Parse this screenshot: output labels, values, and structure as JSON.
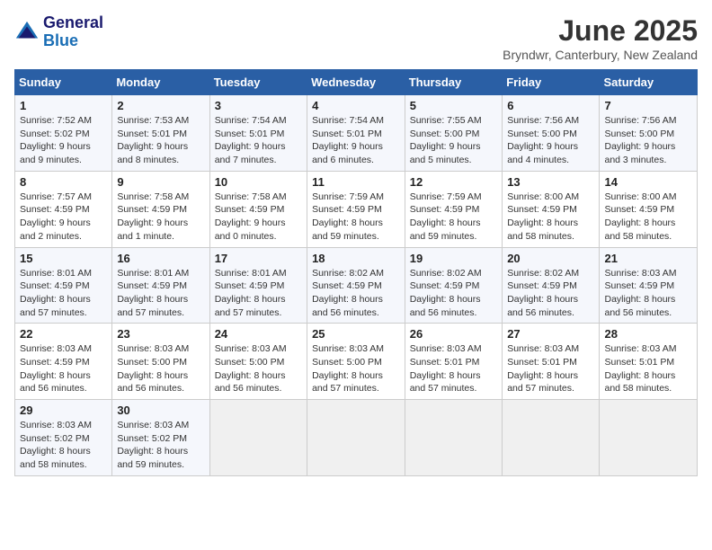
{
  "logo": {
    "text_general": "General",
    "text_blue": "Blue"
  },
  "title": "June 2025",
  "subtitle": "Bryndwr, Canterbury, New Zealand",
  "weekdays": [
    "Sunday",
    "Monday",
    "Tuesday",
    "Wednesday",
    "Thursday",
    "Friday",
    "Saturday"
  ],
  "weeks": [
    [
      {
        "day": "1",
        "content": "Sunrise: 7:52 AM\nSunset: 5:02 PM\nDaylight: 9 hours and 9 minutes."
      },
      {
        "day": "2",
        "content": "Sunrise: 7:53 AM\nSunset: 5:01 PM\nDaylight: 9 hours and 8 minutes."
      },
      {
        "day": "3",
        "content": "Sunrise: 7:54 AM\nSunset: 5:01 PM\nDaylight: 9 hours and 7 minutes."
      },
      {
        "day": "4",
        "content": "Sunrise: 7:54 AM\nSunset: 5:01 PM\nDaylight: 9 hours and 6 minutes."
      },
      {
        "day": "5",
        "content": "Sunrise: 7:55 AM\nSunset: 5:00 PM\nDaylight: 9 hours and 5 minutes."
      },
      {
        "day": "6",
        "content": "Sunrise: 7:56 AM\nSunset: 5:00 PM\nDaylight: 9 hours and 4 minutes."
      },
      {
        "day": "7",
        "content": "Sunrise: 7:56 AM\nSunset: 5:00 PM\nDaylight: 9 hours and 3 minutes."
      }
    ],
    [
      {
        "day": "8",
        "content": "Sunrise: 7:57 AM\nSunset: 4:59 PM\nDaylight: 9 hours and 2 minutes."
      },
      {
        "day": "9",
        "content": "Sunrise: 7:58 AM\nSunset: 4:59 PM\nDaylight: 9 hours and 1 minute."
      },
      {
        "day": "10",
        "content": "Sunrise: 7:58 AM\nSunset: 4:59 PM\nDaylight: 9 hours and 0 minutes."
      },
      {
        "day": "11",
        "content": "Sunrise: 7:59 AM\nSunset: 4:59 PM\nDaylight: 8 hours and 59 minutes."
      },
      {
        "day": "12",
        "content": "Sunrise: 7:59 AM\nSunset: 4:59 PM\nDaylight: 8 hours and 59 minutes."
      },
      {
        "day": "13",
        "content": "Sunrise: 8:00 AM\nSunset: 4:59 PM\nDaylight: 8 hours and 58 minutes."
      },
      {
        "day": "14",
        "content": "Sunrise: 8:00 AM\nSunset: 4:59 PM\nDaylight: 8 hours and 58 minutes."
      }
    ],
    [
      {
        "day": "15",
        "content": "Sunrise: 8:01 AM\nSunset: 4:59 PM\nDaylight: 8 hours and 57 minutes."
      },
      {
        "day": "16",
        "content": "Sunrise: 8:01 AM\nSunset: 4:59 PM\nDaylight: 8 hours and 57 minutes."
      },
      {
        "day": "17",
        "content": "Sunrise: 8:01 AM\nSunset: 4:59 PM\nDaylight: 8 hours and 57 minutes."
      },
      {
        "day": "18",
        "content": "Sunrise: 8:02 AM\nSunset: 4:59 PM\nDaylight: 8 hours and 56 minutes."
      },
      {
        "day": "19",
        "content": "Sunrise: 8:02 AM\nSunset: 4:59 PM\nDaylight: 8 hours and 56 minutes."
      },
      {
        "day": "20",
        "content": "Sunrise: 8:02 AM\nSunset: 4:59 PM\nDaylight: 8 hours and 56 minutes."
      },
      {
        "day": "21",
        "content": "Sunrise: 8:03 AM\nSunset: 4:59 PM\nDaylight: 8 hours and 56 minutes."
      }
    ],
    [
      {
        "day": "22",
        "content": "Sunrise: 8:03 AM\nSunset: 4:59 PM\nDaylight: 8 hours and 56 minutes."
      },
      {
        "day": "23",
        "content": "Sunrise: 8:03 AM\nSunset: 5:00 PM\nDaylight: 8 hours and 56 minutes."
      },
      {
        "day": "24",
        "content": "Sunrise: 8:03 AM\nSunset: 5:00 PM\nDaylight: 8 hours and 56 minutes."
      },
      {
        "day": "25",
        "content": "Sunrise: 8:03 AM\nSunset: 5:00 PM\nDaylight: 8 hours and 57 minutes."
      },
      {
        "day": "26",
        "content": "Sunrise: 8:03 AM\nSunset: 5:01 PM\nDaylight: 8 hours and 57 minutes."
      },
      {
        "day": "27",
        "content": "Sunrise: 8:03 AM\nSunset: 5:01 PM\nDaylight: 8 hours and 57 minutes."
      },
      {
        "day": "28",
        "content": "Sunrise: 8:03 AM\nSunset: 5:01 PM\nDaylight: 8 hours and 58 minutes."
      }
    ],
    [
      {
        "day": "29",
        "content": "Sunrise: 8:03 AM\nSunset: 5:02 PM\nDaylight: 8 hours and 58 minutes."
      },
      {
        "day": "30",
        "content": "Sunrise: 8:03 AM\nSunset: 5:02 PM\nDaylight: 8 hours and 59 minutes."
      },
      {
        "day": "",
        "content": ""
      },
      {
        "day": "",
        "content": ""
      },
      {
        "day": "",
        "content": ""
      },
      {
        "day": "",
        "content": ""
      },
      {
        "day": "",
        "content": ""
      }
    ]
  ]
}
